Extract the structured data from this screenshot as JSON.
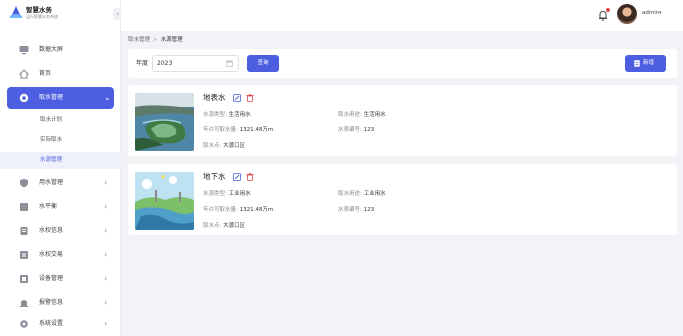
{
  "brand": {
    "title": "智慧水务",
    "subtitle": "运行智慧水务系统"
  },
  "header": {
    "username": "admin",
    "caret": "▾"
  },
  "sidebar": {
    "collapse_glyph": "‹",
    "items": [
      {
        "label": "数据大屏",
        "icon": "monitor-icon"
      },
      {
        "label": "首页",
        "icon": "home-icon"
      },
      {
        "label": "取水管理",
        "icon": "water-drop-icon",
        "active": true,
        "chevron": "⌄"
      },
      {
        "label": "用水管理",
        "icon": "shield-icon",
        "chevron": "›"
      },
      {
        "label": "水平衡",
        "icon": "scale-icon",
        "chevron": "›"
      },
      {
        "label": "水权信息",
        "icon": "document-icon",
        "chevron": "›"
      },
      {
        "label": "水权交易",
        "icon": "exchange-icon",
        "chevron": "›"
      },
      {
        "label": "设备管理",
        "icon": "device-icon",
        "chevron": "›"
      },
      {
        "label": "报警信息",
        "icon": "alarm-icon",
        "chevron": "›"
      },
      {
        "label": "系统设置",
        "icon": "settings-icon",
        "chevron": "›"
      }
    ],
    "sub_items": [
      {
        "label": "取水计划"
      },
      {
        "label": "实际取水"
      },
      {
        "label": "水源管理",
        "current": true
      }
    ]
  },
  "breadcrumb": {
    "parent": "取水管理",
    "sep": ">",
    "current": "水源管理"
  },
  "filter": {
    "year_label": "年度",
    "year_value": "2023",
    "query_label": "查询",
    "add_label": "新增"
  },
  "cards": [
    {
      "title": "地表水",
      "source_type_label": "水源类型:",
      "source_type": "生活用水",
      "usage_label": "取水用途:",
      "usage": "生活用水",
      "allowance_label": "年许可取水量:",
      "allowance": "1321.48万m",
      "meter_label": "水表编号:",
      "meter": "123",
      "location_label": "取水点:",
      "location": "大渡口区"
    },
    {
      "title": "地下水",
      "source_type_label": "水源类型:",
      "source_type": "工业用水",
      "usage_label": "取水用途:",
      "usage": "工业用水",
      "allowance_label": "年许可取水量:",
      "allowance": "1321.48万m",
      "meter_label": "水表编号:",
      "meter": "123",
      "location_label": "取水点:",
      "location": "大渡口区"
    }
  ],
  "colors": {
    "primary": "#4d5fe0",
    "danger": "#e34b4b",
    "bg": "#f2f3f7"
  }
}
